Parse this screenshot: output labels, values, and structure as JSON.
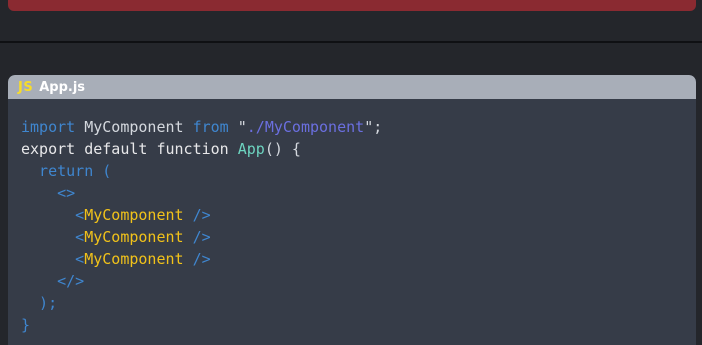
{
  "file": {
    "language_badge": "JS",
    "name": "App.js"
  },
  "code_tokens": {
    "l1": [
      "import",
      " MyComponent ",
      "from",
      " \"",
      "./MyComponent",
      "\";"
    ],
    "l2": [
      "export",
      " default ",
      "function",
      " ",
      "App",
      "() {"
    ],
    "l3": [
      "  return ("
    ],
    "l4": [
      "    <>"
    ],
    "l5": [
      "      <",
      "MyComponent",
      " />"
    ],
    "l6": [
      "      <",
      "MyComponent",
      " />"
    ],
    "l7": [
      "      <",
      "MyComponent",
      " />"
    ],
    "l8": [
      "    </>"
    ],
    "l9": [
      "  );"
    ],
    "l10": [
      "}"
    ]
  },
  "colors": {
    "keyword": "#3f86cf",
    "string": "#6b6fe0",
    "function": "#6dd4c0",
    "component": "#f1c21a",
    "alert_bar": "#8a2a31",
    "code_background": "#363c48"
  }
}
